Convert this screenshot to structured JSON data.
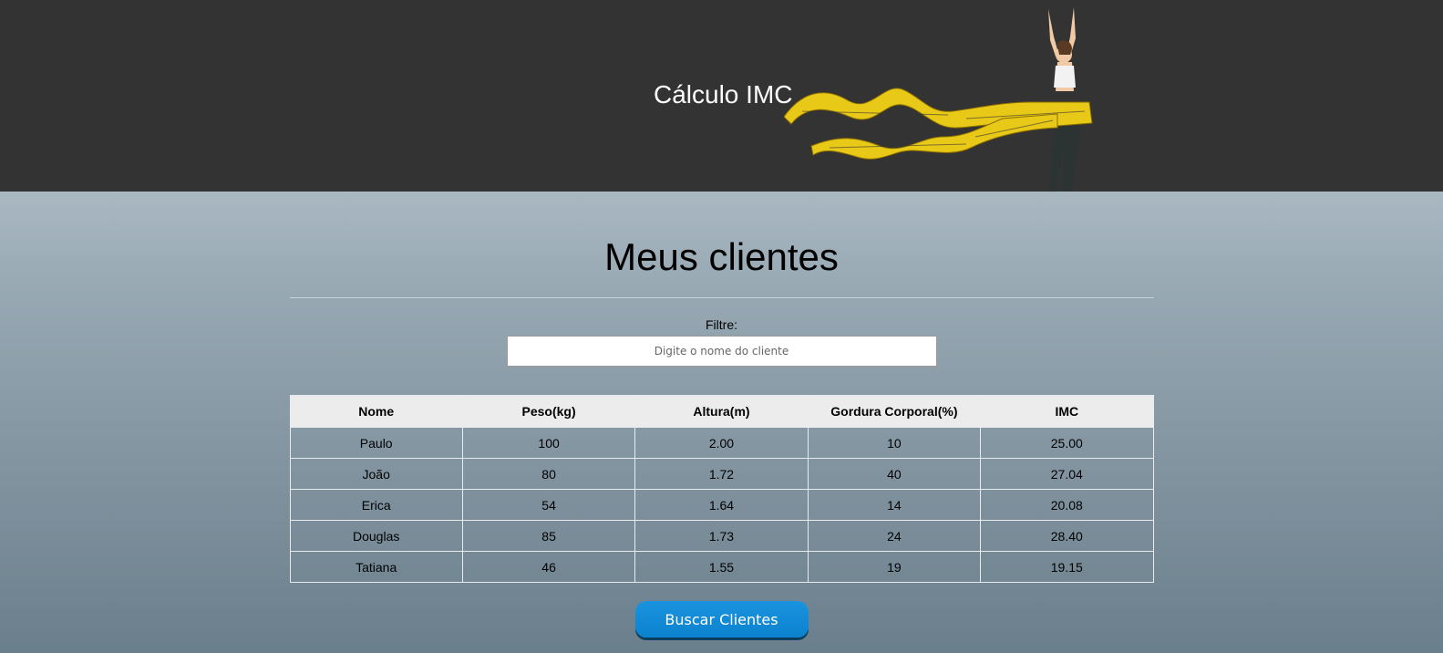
{
  "header": {
    "title": "Cálculo IMC",
    "image_icon": "dancer-with-measuring-tape"
  },
  "main": {
    "title": "Meus clientes",
    "filter": {
      "label": "Filtre:",
      "placeholder": "Digite o nome do cliente"
    },
    "table": {
      "headers": [
        "Nome",
        "Peso(kg)",
        "Altura(m)",
        "Gordura Corporal(%)",
        "IMC"
      ],
      "rows": [
        [
          "Paulo",
          "100",
          "2.00",
          "10",
          "25.00"
        ],
        [
          "João",
          "80",
          "1.72",
          "40",
          "27.04"
        ],
        [
          "Erica",
          "54",
          "1.64",
          "14",
          "20.08"
        ],
        [
          "Douglas",
          "85",
          "1.73",
          "24",
          "28.40"
        ],
        [
          "Tatiana",
          "46",
          "1.55",
          "19",
          "19.15"
        ]
      ]
    },
    "button_label": "Buscar Clientes"
  },
  "colors": {
    "header_bg": "#333333",
    "button": "#0c82cf"
  }
}
